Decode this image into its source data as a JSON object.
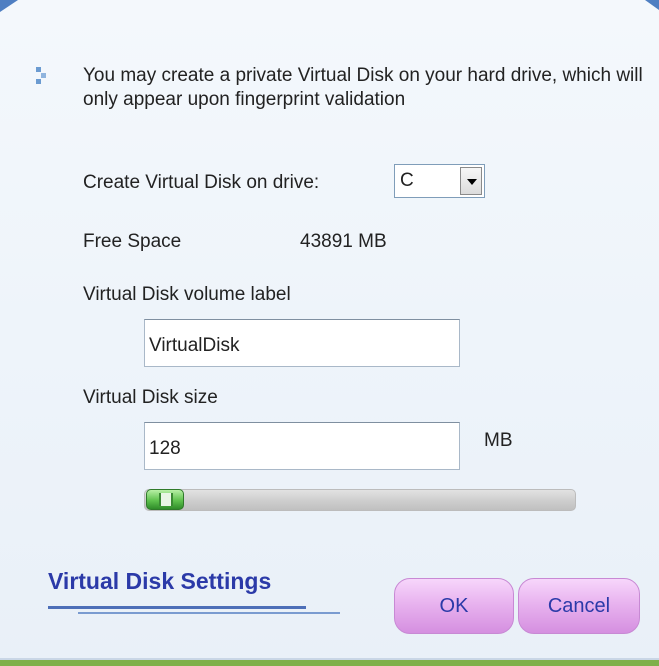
{
  "intro_text": "You may create a private Virtual Disk on your hard drive, which will only appear upon fingerprint validation",
  "drive": {
    "label": "Create Virtual Disk on drive:",
    "selected": "C"
  },
  "free_space": {
    "label": "Free Space",
    "value": "43891 MB"
  },
  "volume_label": {
    "label": "Virtual Disk volume label",
    "value": "VirtualDisk"
  },
  "disk_size": {
    "label": "Virtual Disk size",
    "value": "128",
    "unit": "MB",
    "slider_fraction": 0.0
  },
  "section_title": "Virtual Disk Settings",
  "buttons": {
    "ok": "OK",
    "cancel": "Cancel"
  },
  "colors": {
    "accent_blue": "#2b3aa8",
    "button_pink": "#e8b3ef",
    "thumb_green": "#5fc24e"
  }
}
